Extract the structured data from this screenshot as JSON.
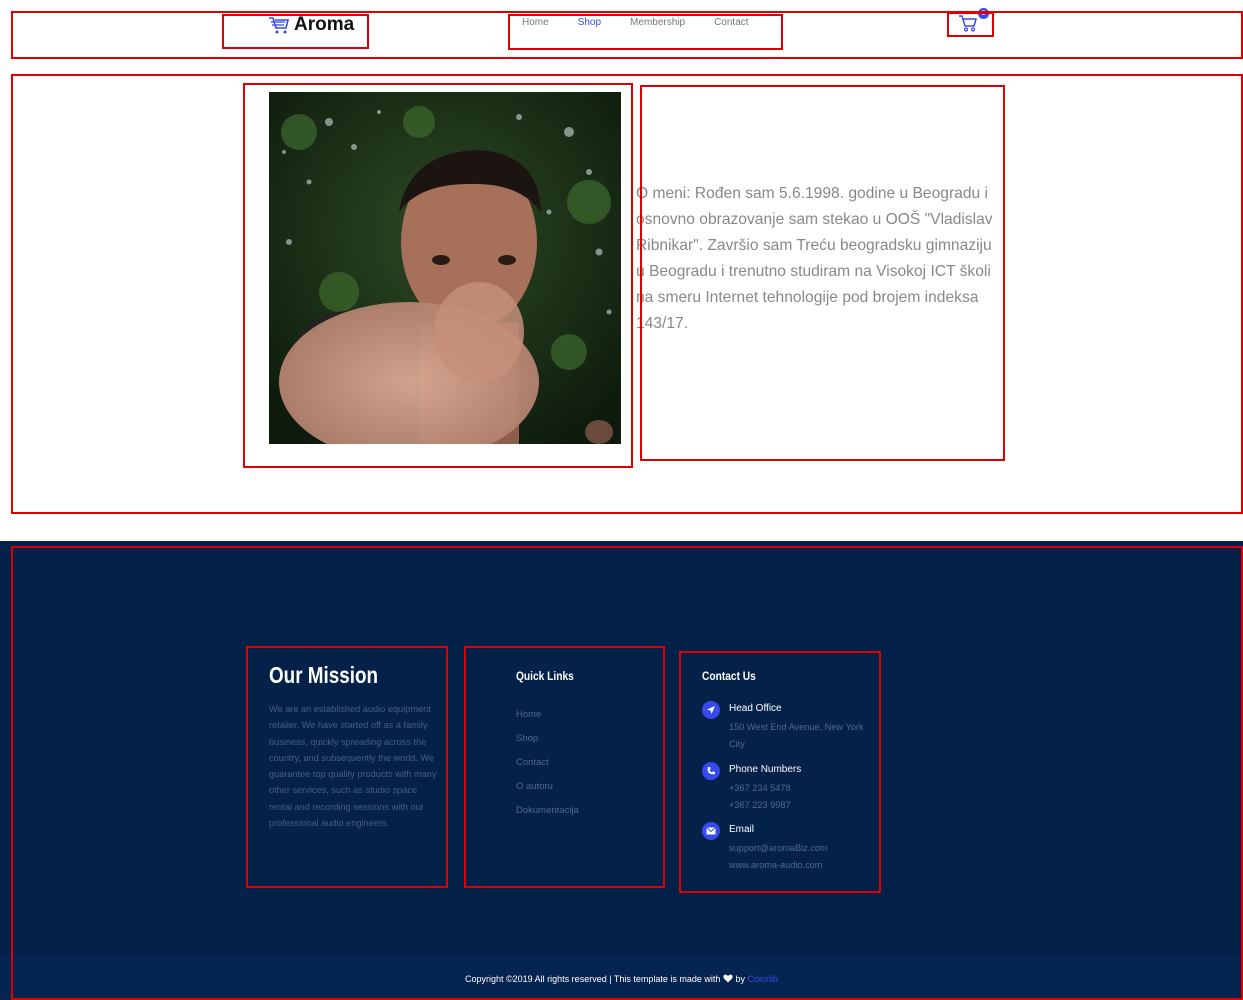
{
  "header": {
    "logo_text": "Aroma",
    "nav": [
      {
        "label": "Home"
      },
      {
        "label": "Shop"
      },
      {
        "label": "Membership"
      },
      {
        "label": "Contact"
      }
    ],
    "active_nav": "Shop",
    "cart_count": "0",
    "accent_color": "#384aeb"
  },
  "about": {
    "photo_icon": "portrait-photo",
    "text": "O meni: Rođen sam 5.6.1998. godine u Beogradu i osnovno obrazovanje sam stekao u OOŠ \"Vladislav Ribnikar\". Završio sam Treću beogradsku gimnaziju u Beogradu i trenutno studiram na Visokoj ICT školi na smeru Internet tehnologije pod brojem indeksa 143/17."
  },
  "footer": {
    "background_color": "#04214a",
    "mission": {
      "title": "Our Mission",
      "text": "We are an established audio equipment retailer. We have started off as a family business, quickly spreading across the country, and subsequently the world. We guarantee top quality products with many other services, such as studio space rental and recording sessions with our professional audio engineers."
    },
    "quick_links": {
      "title": "Quick Links",
      "items": [
        "Home",
        "Shop",
        "Contact",
        "O autoru",
        "Dokumentacija"
      ]
    },
    "contact": {
      "title": "Contact Us",
      "head_office": {
        "label": "Head Office",
        "line1": "150 West End Avenue, New York City",
        "icon": "location-arrow-icon"
      },
      "phone": {
        "label": "Phone Numbers",
        "line1": "+367 234 5478",
        "line2": "+367 223 9987",
        "icon": "phone-icon"
      },
      "email": {
        "label": "Email",
        "line1": "support@aromaBiz.com",
        "line2": "www.aroma-audio.com",
        "icon": "envelope-icon"
      }
    },
    "copyright": {
      "prefix": "Copyright ©2019 All rights reserved | This template is made with",
      "by": "by",
      "author": "Colorlib"
    }
  }
}
